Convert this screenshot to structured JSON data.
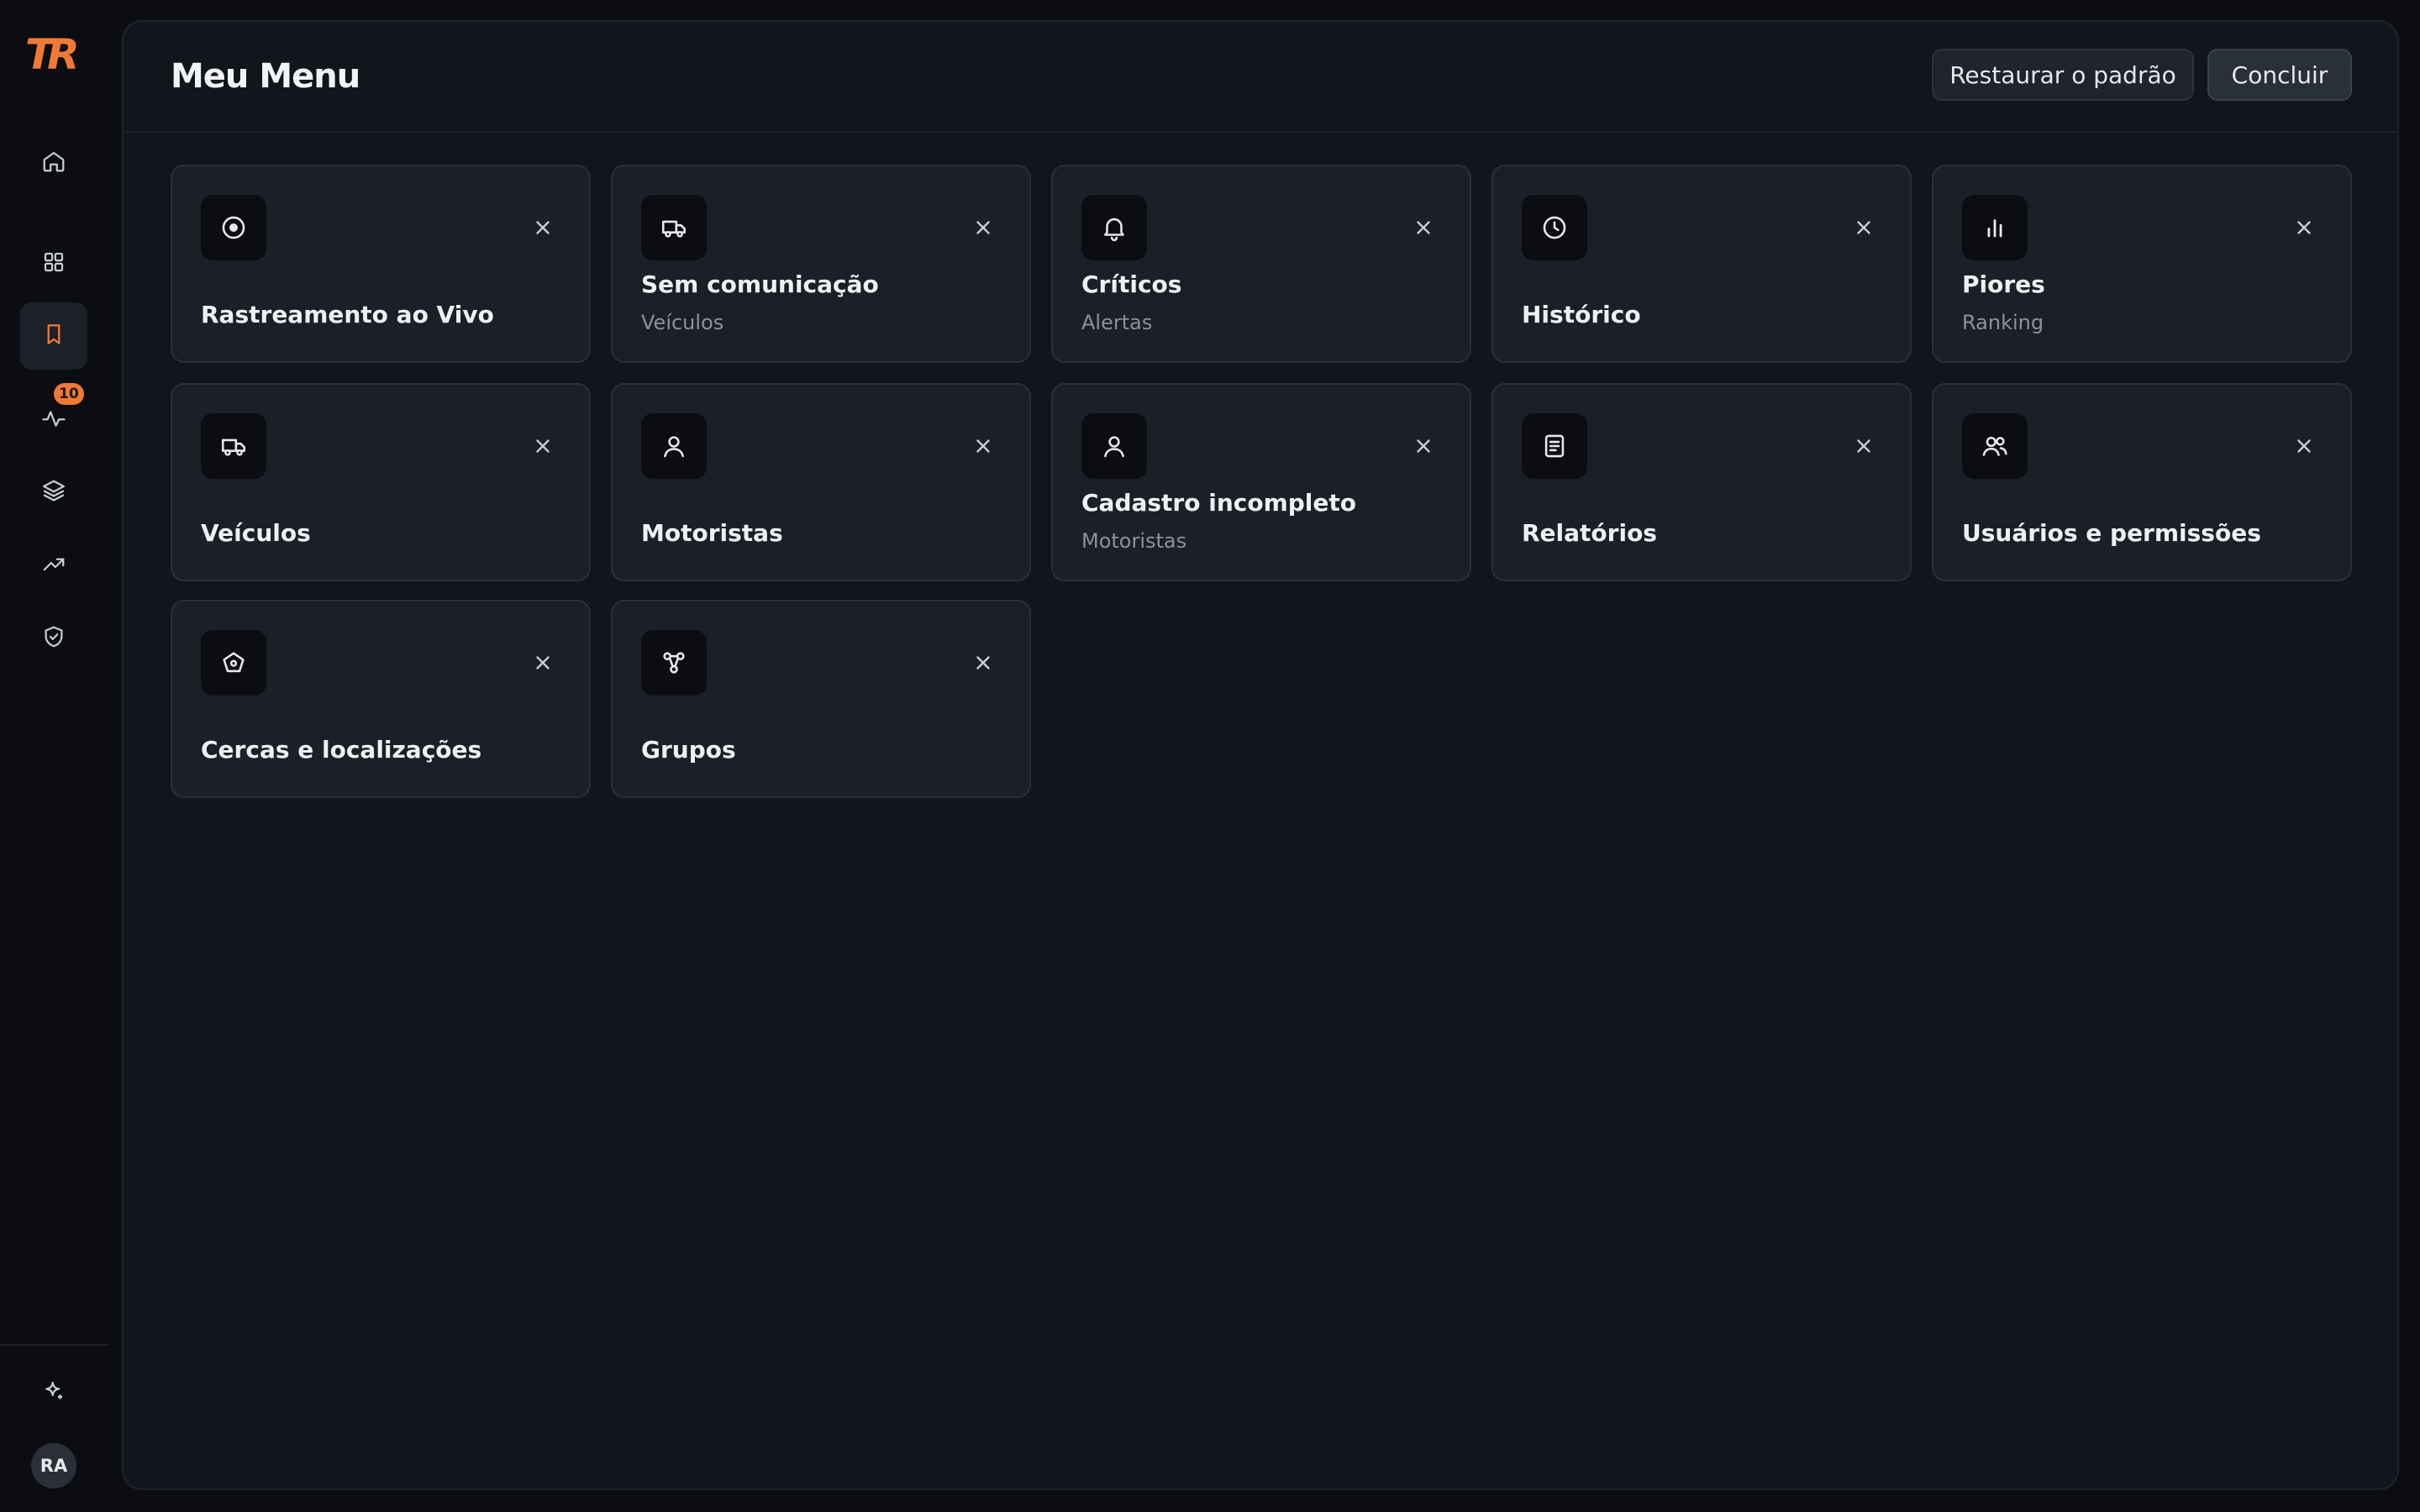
{
  "app": {
    "logo_text": "TR",
    "brand_color": "#f07a35"
  },
  "sidebar": {
    "items": [
      {
        "name": "home",
        "icon": "home-icon"
      },
      {
        "name": "dashboard",
        "icon": "grid-icon"
      },
      {
        "name": "bookmarks",
        "icon": "bookmark-icon",
        "active": true
      },
      {
        "name": "activity",
        "icon": "activity-icon",
        "badge": "10"
      },
      {
        "name": "layers",
        "icon": "layers-icon"
      },
      {
        "name": "trends",
        "icon": "trending-up-icon"
      },
      {
        "name": "security",
        "icon": "shield-check-icon"
      },
      {
        "name": "ai",
        "icon": "sparkle-icon"
      }
    ],
    "user_initials": "RA"
  },
  "header": {
    "title": "Meu Menu",
    "restore_label": "Restaurar o padrão",
    "done_label": "Concluir"
  },
  "cards": [
    {
      "title": "Rastreamento ao Vivo",
      "subtitle": "",
      "icon": "target-icon"
    },
    {
      "title": "Sem comunicação",
      "subtitle": "Veículos",
      "icon": "truck-icon"
    },
    {
      "title": "Críticos",
      "subtitle": "Alertas",
      "icon": "bell-icon"
    },
    {
      "title": "Histórico",
      "subtitle": "",
      "icon": "clock-icon"
    },
    {
      "title": "Piores",
      "subtitle": "Ranking",
      "icon": "bar-chart-icon"
    },
    {
      "title": "Veículos",
      "subtitle": "",
      "icon": "truck-icon"
    },
    {
      "title": "Motoristas",
      "subtitle": "",
      "icon": "user-icon"
    },
    {
      "title": "Cadastro incompleto",
      "subtitle": "Motoristas",
      "icon": "user-icon"
    },
    {
      "title": "Relatórios",
      "subtitle": "",
      "icon": "document-icon"
    },
    {
      "title": "Usuários e permissões",
      "subtitle": "",
      "icon": "users-icon"
    },
    {
      "title": "Cercas e localizações",
      "subtitle": "",
      "icon": "geofence-icon"
    },
    {
      "title": "Grupos",
      "subtitle": "",
      "icon": "groups-icon"
    }
  ]
}
